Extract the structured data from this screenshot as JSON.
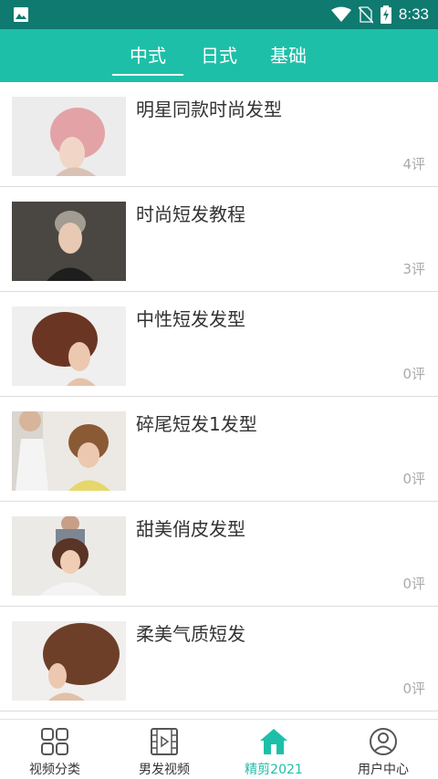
{
  "status_bar": {
    "time": "8:33",
    "icons": [
      "image-icon",
      "wifi-icon",
      "no-sim-icon",
      "battery-charging-icon"
    ]
  },
  "tabs": [
    {
      "label": "中式",
      "active": true
    },
    {
      "label": "日式",
      "active": false
    },
    {
      "label": "基础",
      "active": false
    }
  ],
  "videos": [
    {
      "title": "明星同款时尚发型",
      "comments": "4评"
    },
    {
      "title": "时尚短发教程",
      "comments": "3评"
    },
    {
      "title": "中性短发发型",
      "comments": "0评"
    },
    {
      "title": "碎尾短发1发型",
      "comments": "0评"
    },
    {
      "title": "甜美俏皮发型",
      "comments": "0评"
    },
    {
      "title": "柔美气质短发",
      "comments": "0评"
    }
  ],
  "bottom_nav": [
    {
      "label": "视频分类",
      "icon": "grid-icon",
      "active": false
    },
    {
      "label": "男发视频",
      "icon": "film-icon",
      "active": false
    },
    {
      "label": "精剪2021",
      "icon": "home-icon",
      "active": true
    },
    {
      "label": "用户中心",
      "icon": "user-icon",
      "active": false
    }
  ],
  "colors": {
    "status_bar": "#0e7a70",
    "header": "#1ebfa8",
    "accent": "#1ebfa8",
    "comment_text": "#aaaaaa"
  }
}
